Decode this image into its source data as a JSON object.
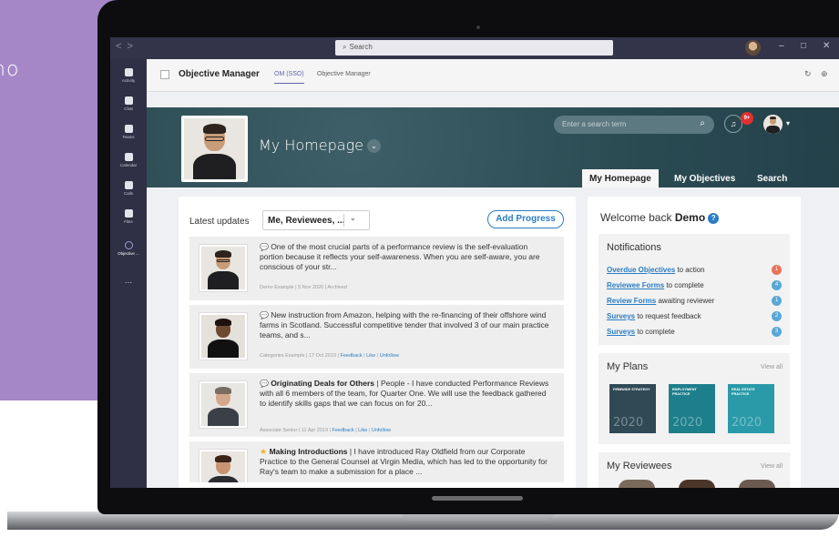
{
  "side_text": "no",
  "teams": {
    "search_placeholder": "Search",
    "nav_back": "<",
    "nav_forward": ">",
    "win_min": "–",
    "win_max": "□",
    "win_close": "✕",
    "rail": [
      {
        "label": "Activity"
      },
      {
        "label": "Chat"
      },
      {
        "label": "Teams"
      },
      {
        "label": "Calendar"
      },
      {
        "label": "Calls"
      },
      {
        "label": "Files"
      },
      {
        "label": "Objective ..."
      },
      {
        "label": "..."
      }
    ]
  },
  "app": {
    "title": "Objective Manager",
    "tabs": [
      "OM (SSO)",
      "Objective Manager"
    ],
    "refresh": "↻",
    "globe": "⊕"
  },
  "om": {
    "page_title": "My Homepage",
    "search_placeholder": "Enter a search term",
    "search_icon": "⌕",
    "bell_icon": "🔔",
    "notif_count": "9+",
    "avatar_caret": "▾",
    "tabs": [
      "My Homepage",
      "My Objectives",
      "Search"
    ],
    "latest": {
      "label": "Latest updates",
      "filter": "Me, Reviewees, ...",
      "add_progress": "Add Progress",
      "items": [
        {
          "bold": "",
          "text": "One of the most crucial parts of a performance review is the self-evaluation portion because it reflects your self-awareness. When you are self-aware, you are conscious of your str...",
          "meta": "Demo Example | 5 Nov 2020 | Archived",
          "links": []
        },
        {
          "bold": "",
          "text": "New instruction from Amazon, helping with the re-financing of their offshore wind farms in Scotland. Successful competitive tender that involved 3 of our main practice teams, and s...",
          "meta": "Categories Example | 17 Oct 2019 |",
          "links": [
            "Feedback",
            "Like",
            "Unfollow"
          ]
        },
        {
          "bold": "Originating Deals for Others",
          "text": " | People - I have conducted Performance Reviews with all 6 members of the team, for Quarter One. We will use the feedback gathered to identify skills gaps that we can focus on for 20...",
          "meta": "Associate Senior | 11 Apr 2019 |",
          "links": [
            "Feedback",
            "Like",
            "Unfollow"
          ]
        },
        {
          "bold": "Making Introductions",
          "text": " | I have introduced Ray Oldfield from our Corporate Practice to the General Counsel at Virgin Media, which has led to the opportunity for Ray's team to make a submission for a place ...",
          "meta": "",
          "links": []
        }
      ]
    },
    "welcome": {
      "prefix": "Welcome back",
      "name": "Demo",
      "help_icon": "?"
    },
    "notifications": {
      "title": "Notifications",
      "items": [
        {
          "link": "Overdue Objectives",
          "rest": " to action",
          "count": "1",
          "color": "#e8735a"
        },
        {
          "link": "Reviewee Forms",
          "rest": " to complete",
          "count": "4",
          "color": "#5aa8d6"
        },
        {
          "link": "Review Forms",
          "rest": " awaiting reviewer",
          "count": "1",
          "color": "#5aa8d6"
        },
        {
          "link": "Surveys",
          "rest": " to request feedback",
          "count": "2",
          "color": "#5aa8d6"
        },
        {
          "link": "Surveys",
          "rest": " to complete",
          "count": "3",
          "color": "#5aa8d6"
        }
      ]
    },
    "plans": {
      "title": "My Plans",
      "view_all": "View all",
      "items": [
        {
          "label": "FIRMWIDE STRATEGY",
          "year": "2020",
          "color": "#2f4a55"
        },
        {
          "label": "EMPLOYMENT PRACTICE",
          "year": "2020",
          "color": "#1e7f8c"
        },
        {
          "label": "REAL ESTATE PRACTICE",
          "year": "2020",
          "color": "#2a9aa8"
        }
      ]
    },
    "reviewees": {
      "title": "My Reviewees",
      "view_all": "View all"
    }
  }
}
